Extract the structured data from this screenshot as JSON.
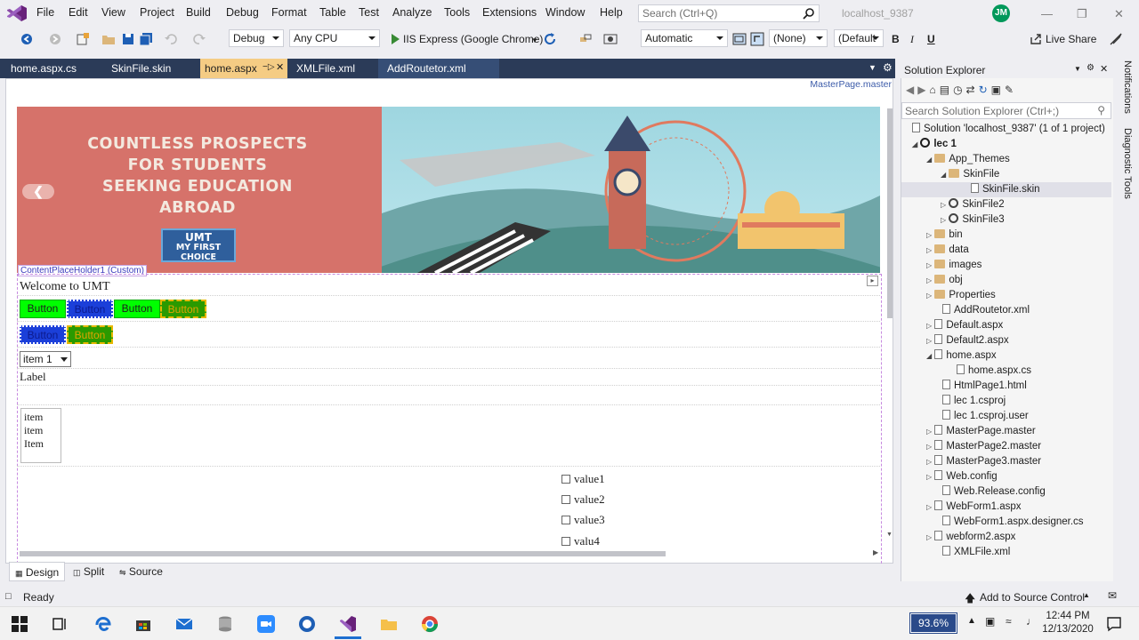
{
  "menu": [
    "File",
    "Edit",
    "View",
    "Project",
    "Build",
    "Debug",
    "Format",
    "Table",
    "Test",
    "Analyze",
    "Tools",
    "Extensions",
    "Window",
    "Help"
  ],
  "search": {
    "placeholder": "Search (Ctrl+Q)"
  },
  "solution_name": "localhost_9387",
  "user_initials": "JM",
  "toolbar": {
    "config": "Debug",
    "platform": "Any CPU",
    "run_target": "IIS Express (Google Chrome)",
    "auto": "Automatic",
    "style": "(None)",
    "font": "(Default",
    "bold": "B",
    "italic": "I",
    "underline": "U",
    "live_share": "Live Share"
  },
  "tabs": [
    {
      "label": "home.aspx.cs"
    },
    {
      "label": "SkinFile.skin"
    },
    {
      "label": "home.aspx"
    },
    {
      "label": "XMLFile.xml"
    },
    {
      "label": "AddRoutetor.xml"
    }
  ],
  "designer": {
    "master_label": "MasterPage.master",
    "banner_title": "COUNTLESS PROSPECTS FOR STUDENTS SEEKING EDUCATION ABROAD",
    "banner_badge_1": "UMT",
    "banner_badge_2": "MY FIRST CHOICE",
    "cph_label": "ContentPlaceHolder1 (Custom)",
    "welcome": "Welcome to UMT",
    "buttons_row1": [
      "Button",
      "Button",
      "Button",
      "Button"
    ],
    "buttons_row2": [
      "Button",
      "Button"
    ],
    "dropdown_value": "item 1",
    "label": "Label",
    "listbox_items": [
      "item",
      "item",
      "Item"
    ],
    "checkboxes": [
      "value1",
      "value2",
      "value3",
      "valu4"
    ]
  },
  "view_tabs": [
    "Design",
    "Split",
    "Source"
  ],
  "solution_explorer": {
    "title": "Solution Explorer",
    "search_placeholder": "Search Solution Explorer (Ctrl+;)",
    "nodes": [
      {
        "label": "Solution 'localhost_9387' (1 of 1 project)"
      },
      {
        "label": "lec 1"
      },
      {
        "label": "App_Themes"
      },
      {
        "label": "SkinFile"
      },
      {
        "label": "SkinFile.skin"
      },
      {
        "label": "SkinFile2"
      },
      {
        "label": "SkinFile3"
      },
      {
        "label": "bin"
      },
      {
        "label": "data"
      },
      {
        "label": "images"
      },
      {
        "label": "obj"
      },
      {
        "label": "Properties"
      },
      {
        "label": "AddRoutetor.xml"
      },
      {
        "label": "Default.aspx"
      },
      {
        "label": "Default2.aspx"
      },
      {
        "label": "home.aspx"
      },
      {
        "label": "home.aspx.cs"
      },
      {
        "label": "HtmlPage1.html"
      },
      {
        "label": "lec 1.csproj"
      },
      {
        "label": "lec 1.csproj.user"
      },
      {
        "label": "MasterPage.master"
      },
      {
        "label": "MasterPage2.master"
      },
      {
        "label": "MasterPage3.master"
      },
      {
        "label": "Web.config"
      },
      {
        "label": "Web.Release.config"
      },
      {
        "label": "WebForm1.aspx"
      },
      {
        "label": "WebForm1.aspx.designer.cs"
      },
      {
        "label": "webform2.aspx"
      },
      {
        "label": "XMLFile.xml"
      }
    ]
  },
  "side_tabs": [
    "Notifications",
    "Diagnostic Tools"
  ],
  "status": {
    "text": "Ready",
    "source_control": "Add to Source Control"
  },
  "taskbar": {
    "zoom": "93.6%",
    "time": "12:44 PM",
    "date": "12/13/2020"
  }
}
